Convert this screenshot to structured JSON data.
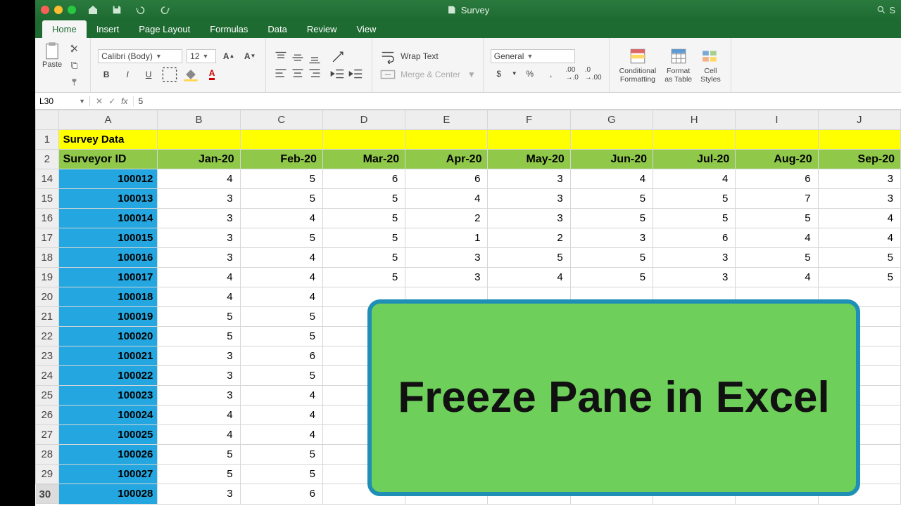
{
  "window": {
    "doc_title": "Survey",
    "search_placeholder": "S"
  },
  "tabs": [
    "Home",
    "Insert",
    "Page Layout",
    "Formulas",
    "Data",
    "Review",
    "View"
  ],
  "active_tab_index": 0,
  "ribbon": {
    "paste_label": "Paste",
    "font_name": "Calibri (Body)",
    "font_size": "12",
    "bold": "B",
    "italic": "I",
    "underline": "U",
    "wrap": "Wrap Text",
    "merge": "Merge & Center",
    "number_format": "General",
    "currency": "$",
    "percent": "%",
    "comma": ",",
    "cond": "Conditional\nFormatting",
    "fmt_table": "Format\nas Table",
    "cell_styles": "Cell\nStyles"
  },
  "formula_bar": {
    "name_box": "L30",
    "value": "5"
  },
  "sheet": {
    "columns": [
      "A",
      "B",
      "C",
      "D",
      "E",
      "F",
      "G",
      "H",
      "I",
      "J"
    ],
    "title": "Survey Data",
    "header_first": "Surveyor ID",
    "months": [
      "Jan-20",
      "Feb-20",
      "Mar-20",
      "Apr-20",
      "May-20",
      "Jun-20",
      "Jul-20",
      "Aug-20",
      "Sep-20"
    ],
    "row_numbers": [
      14,
      15,
      16,
      17,
      18,
      19,
      20,
      21,
      22,
      23,
      24,
      25,
      26,
      27,
      28,
      29,
      30
    ],
    "rows": [
      {
        "id": "100012",
        "v": [
          4,
          5,
          6,
          6,
          3,
          4,
          4,
          6,
          3
        ]
      },
      {
        "id": "100013",
        "v": [
          3,
          5,
          5,
          4,
          3,
          5,
          5,
          7,
          3
        ]
      },
      {
        "id": "100014",
        "v": [
          3,
          4,
          5,
          2,
          3,
          5,
          5,
          5,
          4
        ]
      },
      {
        "id": "100015",
        "v": [
          3,
          5,
          5,
          1,
          2,
          3,
          6,
          4,
          4
        ]
      },
      {
        "id": "100016",
        "v": [
          3,
          4,
          5,
          3,
          5,
          5,
          3,
          5,
          5
        ]
      },
      {
        "id": "100017",
        "v": [
          4,
          4,
          5,
          3,
          4,
          5,
          3,
          4,
          5
        ]
      },
      {
        "id": "100018",
        "v": [
          4,
          4,
          "",
          "",
          "",
          "",
          "",
          "",
          ""
        ]
      },
      {
        "id": "100019",
        "v": [
          5,
          5,
          "",
          "",
          "",
          "",
          "",
          "",
          ""
        ]
      },
      {
        "id": "100020",
        "v": [
          5,
          5,
          "",
          "",
          "",
          "",
          "",
          "",
          ""
        ]
      },
      {
        "id": "100021",
        "v": [
          3,
          6,
          "",
          "",
          "",
          "",
          "",
          "",
          ""
        ]
      },
      {
        "id": "100022",
        "v": [
          3,
          5,
          "",
          "",
          "",
          "",
          "",
          "",
          ""
        ]
      },
      {
        "id": "100023",
        "v": [
          3,
          4,
          "",
          "",
          "",
          "",
          "",
          "",
          ""
        ]
      },
      {
        "id": "100024",
        "v": [
          4,
          4,
          "",
          "",
          "",
          "",
          "",
          "",
          ""
        ]
      },
      {
        "id": "100025",
        "v": [
          4,
          4,
          "",
          "",
          "",
          "",
          "",
          "",
          ""
        ]
      },
      {
        "id": "100026",
        "v": [
          5,
          5,
          "",
          "",
          "",
          "",
          "",
          "",
          ""
        ]
      },
      {
        "id": "100027",
        "v": [
          5,
          5,
          "",
          "",
          "",
          "",
          "",
          "",
          ""
        ]
      },
      {
        "id": "100028",
        "v": [
          3,
          6,
          "",
          "",
          "",
          "",
          "",
          "",
          ""
        ]
      }
    ],
    "selected_row_number": 30
  },
  "callout": "Freeze Pane in Excel"
}
